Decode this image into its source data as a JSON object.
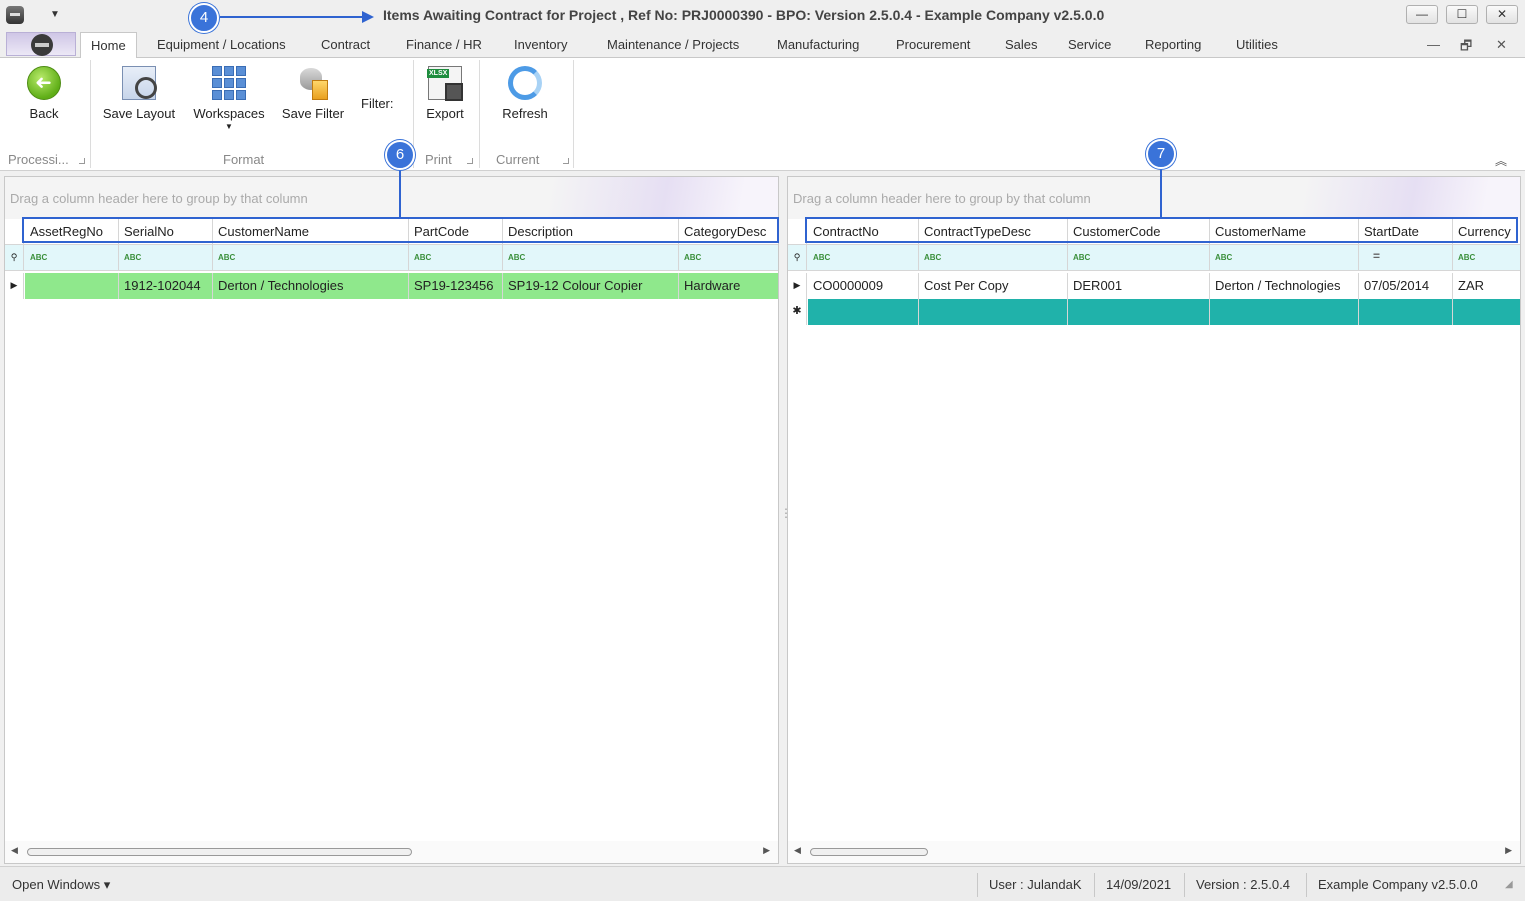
{
  "window": {
    "title": "Items Awaiting Contract for Project , Ref No: PRJ0000390 - BPO: Version 2.5.0.4 - Example Company v2.5.0.0",
    "minimize": "—",
    "maximize": "☐",
    "close": "✕"
  },
  "ribbon_tabs": [
    "Home",
    "Equipment / Locations",
    "Contract",
    "Finance / HR",
    "Inventory",
    "Maintenance / Projects",
    "Manufacturing",
    "Procurement",
    "Sales",
    "Service",
    "Reporting",
    "Utilities"
  ],
  "mdi": {
    "minimize": "—",
    "restore": "🗗",
    "close": "✕"
  },
  "ribbon": {
    "back": "Back",
    "save_layout": "Save Layout",
    "workspaces": "Workspaces",
    "save_filter": "Save Filter",
    "filter_label": "Filter:",
    "export": "Export",
    "refresh": "Refresh",
    "groups": {
      "processing": "Processi...",
      "format": "Format",
      "print": "Print",
      "current": "Current"
    }
  },
  "callouts": {
    "c4": "4",
    "c6": "6",
    "c7": "7"
  },
  "left_grid": {
    "group_hint": "Drag a column header here to group by that column",
    "columns": [
      "AssetRegNo",
      "SerialNo",
      "CustomerName",
      "PartCode",
      "Description",
      "CategoryDesc"
    ],
    "filter_glyph": "ABC",
    "rows": [
      [
        "",
        "1912-102044",
        "Derton / Technologies",
        "SP19-123456",
        "SP19-12 Colour Copier",
        "Hardware"
      ]
    ]
  },
  "right_grid": {
    "group_hint": "Drag a column header here to group by that column",
    "columns": [
      "ContractNo",
      "ContractTypeDesc",
      "CustomerCode",
      "CustomerName",
      "StartDate",
      "Currency"
    ],
    "filter_glyph": "ABC",
    "date_filter_glyph": "=",
    "rows": [
      [
        "CO0000009",
        "Cost Per Copy",
        "DER001",
        "Derton / Technologies",
        "07/05/2014",
        "ZAR"
      ]
    ]
  },
  "status": {
    "open_windows": "Open Windows ▾",
    "user": "User : JulandaK",
    "date": "14/09/2021",
    "version": "Version : 2.5.0.4",
    "company": "Example Company v2.5.0.0"
  },
  "colors": {
    "selected_row": "#8fe88c",
    "new_row": "#20b2aa",
    "callout": "#3a73d9"
  }
}
